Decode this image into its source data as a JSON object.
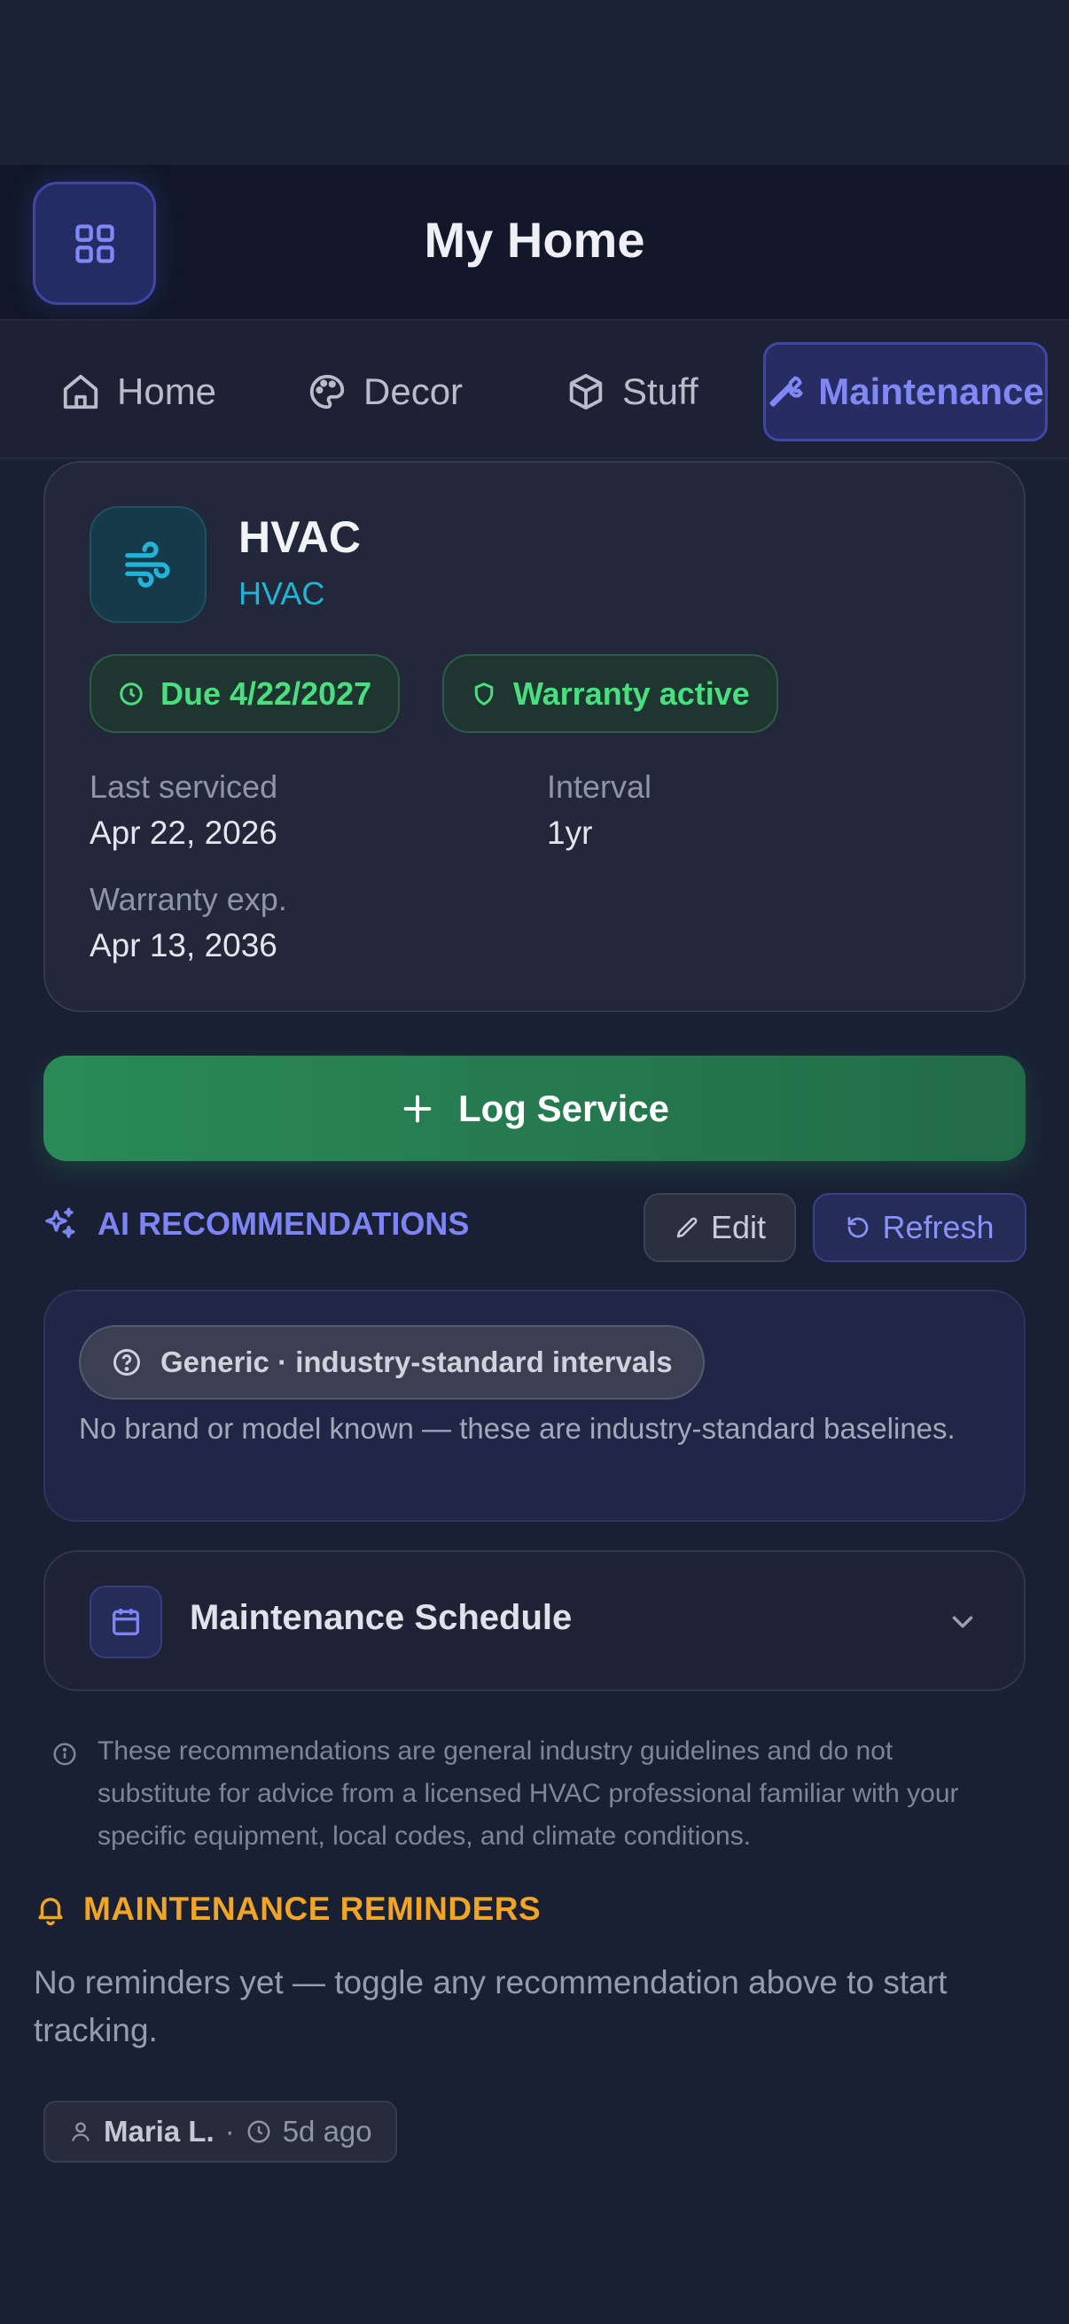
{
  "header": {
    "title": "My Home"
  },
  "tabs": [
    {
      "label": "Home",
      "icon": "house-icon"
    },
    {
      "label": "Decor",
      "icon": "palette-icon"
    },
    {
      "label": "Stuff",
      "icon": "box-icon"
    },
    {
      "label": "Maintenance",
      "icon": "wrench-icon",
      "active": true
    }
  ],
  "item": {
    "title": "HVAC",
    "category": "HVAC",
    "due_badge": "Due 4/22/2027",
    "warranty_badge": "Warranty active",
    "last_serviced_label": "Last serviced",
    "last_serviced_value": "Apr 22, 2026",
    "interval_label": "Interval",
    "interval_value": "1yr",
    "warranty_exp_label": "Warranty exp.",
    "warranty_exp_value": "Apr 13, 2036"
  },
  "log_button": "Log Service",
  "ai": {
    "title": "AI RECOMMENDATIONS",
    "edit_label": "Edit",
    "refresh_label": "Refresh",
    "badge": "Generic · industry-standard intervals",
    "note": "No brand or model known — these are industry-standard baselines."
  },
  "schedule": {
    "title": "Maintenance Schedule"
  },
  "disclaimer": "These recommendations are general industry guidelines and do not substitute for advice from a licensed HVAC professional familiar with your specific equipment, local codes, and climate conditions.",
  "reminders": {
    "title": "MAINTENANCE REMINDERS",
    "empty_text": "No reminders yet — toggle any recommendation above to start tracking."
  },
  "author": {
    "name": "Maria L.",
    "separator": "·",
    "time": "5d ago"
  },
  "colors": {
    "accent": "#7c85f3",
    "success": "#4ade80",
    "warning": "#f0a526",
    "hvac": "#22b4d6"
  }
}
